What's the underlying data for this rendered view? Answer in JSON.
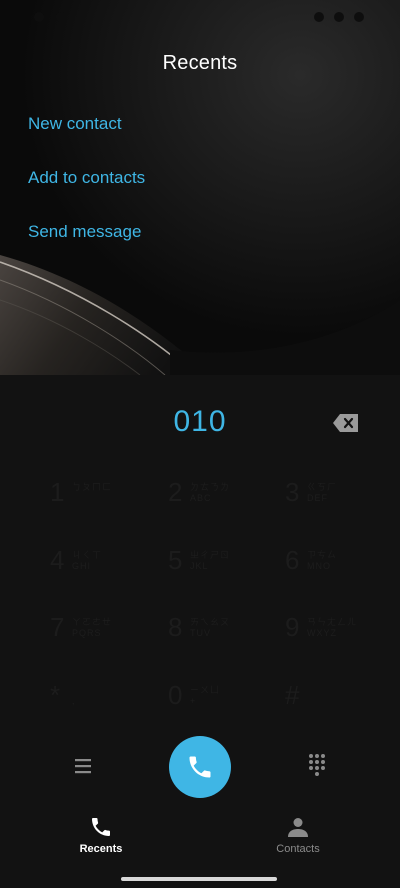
{
  "header": {
    "title": "Recents"
  },
  "menu": {
    "new_contact": "New contact",
    "add_to_contacts": "Add to contacts",
    "send_message": "Send message"
  },
  "dialer": {
    "number": "010",
    "keys": [
      {
        "digit": "1",
        "line1": "ㄅㄆㄇㄈ",
        "line2": ""
      },
      {
        "digit": "2",
        "line1": "ㄉㄊㄋㄌ",
        "line2": "ABC"
      },
      {
        "digit": "3",
        "line1": "ㄍㄎㄏ",
        "line2": "DEF"
      },
      {
        "digit": "4",
        "line1": "ㄐㄑㄒ",
        "line2": "GHI"
      },
      {
        "digit": "5",
        "line1": "ㄓㄔㄕㄖ",
        "line2": "JKL"
      },
      {
        "digit": "6",
        "line1": "ㄗㄘㄙ",
        "line2": "MNO"
      },
      {
        "digit": "7",
        "line1": "ㄚㄛㄜㄝ",
        "line2": "PQRS"
      },
      {
        "digit": "8",
        "line1": "ㄞㄟㄠㄡ",
        "line2": "TUV"
      },
      {
        "digit": "9",
        "line1": "ㄢㄣㄤㄥㄦ",
        "line2": "WXYZ"
      },
      {
        "digit": "*",
        "line1": "",
        "line2": ","
      },
      {
        "digit": "0",
        "line1": "ㄧㄨㄩ",
        "line2": "+"
      },
      {
        "digit": "#",
        "line1": "",
        "line2": ""
      }
    ]
  },
  "nav": {
    "recents_label": "Recents",
    "contacts_label": "Contacts"
  },
  "icons": {
    "backspace": "backspace-icon",
    "menu": "menu-icon",
    "call": "phone-icon",
    "dialpad": "dialpad-icon",
    "recents": "phone-icon",
    "contacts": "person-icon"
  },
  "colors": {
    "accent": "#3fb6e5",
    "background": "#121212",
    "active_nav": "#ffffff",
    "inactive_nav": "#8a8a8a"
  }
}
